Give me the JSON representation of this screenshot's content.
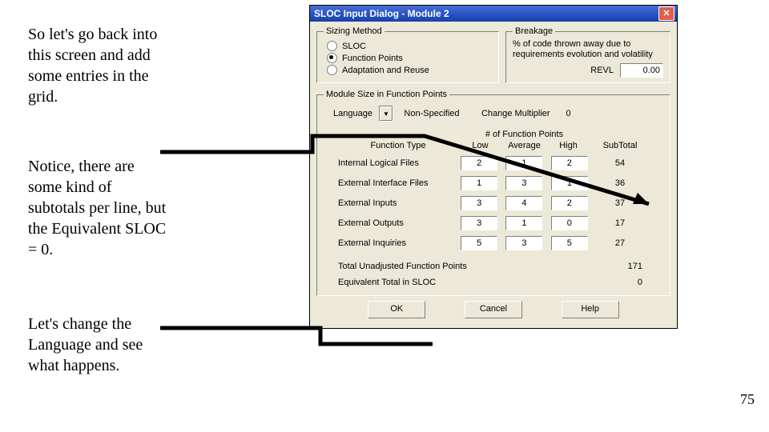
{
  "narrative": {
    "p1": "So let's go back into this screen and add some entries in the grid.",
    "p2": "Notice, there are some kind of subtotals per line, but the Equivalent SLOC = 0.",
    "p3": "Let's change the Language and see what happens."
  },
  "dialog": {
    "title": "SLOC Input Dialog - Module 2",
    "sizing": {
      "legend": "Sizing Method",
      "options": [
        "SLOC",
        "Function Points",
        "Adaptation and Reuse"
      ],
      "selected": 1
    },
    "breakage": {
      "legend": "Breakage",
      "desc": "% of code thrown away due to requirements evolution and volatility",
      "revl_label": "REVL",
      "revl_value": "0.00"
    },
    "module": {
      "legend": "Module Size in Function Points",
      "language_label": "Language",
      "language_value": "Non-Specified",
      "change_mult_label": "Change Multiplier",
      "change_mult_value": "0",
      "headers": {
        "type": "Function Type",
        "fp": "# of Function Points",
        "low": "Low",
        "avg": "Average",
        "high": "High",
        "sub": "SubTotal"
      },
      "rows": [
        {
          "name": "Internal Logical Files",
          "low": "2",
          "avg": "1",
          "high": "2",
          "sub": "54"
        },
        {
          "name": "External Interface Files",
          "low": "1",
          "avg": "3",
          "high": "1",
          "sub": "36"
        },
        {
          "name": "External Inputs",
          "low": "3",
          "avg": "4",
          "high": "2",
          "sub": "37"
        },
        {
          "name": "External Outputs",
          "low": "3",
          "avg": "1",
          "high": "0",
          "sub": "17"
        },
        {
          "name": "External Inquiries",
          "low": "5",
          "avg": "3",
          "high": "5",
          "sub": "27"
        }
      ],
      "total_label": "Total Unadjusted Function Points",
      "total_value": "171",
      "equiv_label": "Equivalent Total in SLOC",
      "equiv_value": "0"
    },
    "buttons": {
      "ok": "OK",
      "cancel": "Cancel",
      "help": "Help"
    }
  },
  "page_number": "75"
}
